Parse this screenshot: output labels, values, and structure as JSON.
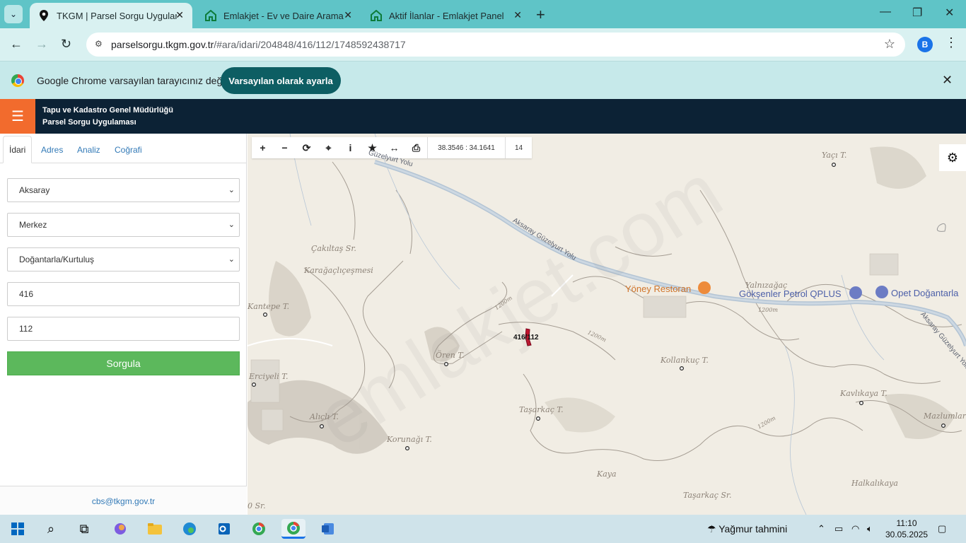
{
  "browser": {
    "tabs": [
      {
        "title": "TKGM | Parsel Sorgu Uygulaması",
        "active": true,
        "icon": "map-pin-icon"
      },
      {
        "title": "Emlakjet - Ev ve Daire Aramanın",
        "active": false,
        "icon": "house-icon"
      },
      {
        "title": "Aktif İlanlar - Emlakjet Panel",
        "active": false,
        "icon": "house-icon"
      }
    ],
    "url_host": "parselsorgu.tkgm.gov.tr",
    "url_path": "/#ara/idari/204848/416/112/1748592438717",
    "profile_initial": "B",
    "infobar_text": "Google Chrome varsayılan tarayıcınız değil",
    "infobar_button": "Varsayılan olarak ayarla"
  },
  "app": {
    "title_line1": "Tapu ve Kadastro Genel Müdürlüğü",
    "title_line2": "Parsel Sorgu Uygulaması",
    "accent": "#f26b2d",
    "header_bg": "#0c2235"
  },
  "sidebar": {
    "tabs": [
      "İdari",
      "Adres",
      "Analiz",
      "Coğrafi"
    ],
    "il": "Aksaray",
    "ilce": "Merkez",
    "mahalle": "Doğantarla/Kurtuluş",
    "ada": "416",
    "parsel": "112",
    "submit": "Sorgula",
    "email": "cbs@tkgm.gov.tr"
  },
  "map": {
    "coordinates": "38.3546 : 34.1641",
    "zoom": "14",
    "parcel_label": "416/112",
    "watermark": "emlakjet.com",
    "places": {
      "cakiltas": "Çakıltaş Sr.",
      "kavaklar": "Karağaçlıçeşmesi",
      "kantepe": "Kantepe T.",
      "oren": "Ören T.",
      "ercekli": "Erciyeli T.",
      "alici": "Alıçlı T.",
      "korunagi": "Korunağı T.",
      "tasarkac": "Taşarkaç T.",
      "tasarkac_sr": "Taşarkaç Sr.",
      "kollankuc": "Kollankuç T.",
      "kavlakaya": "Kavlıkaya T.",
      "mazlumlar": "Mazlumlar",
      "kaya": "Kaya",
      "halkalikaya": "Halkalıkaya",
      "yalnizagac": "Yalnızağaç",
      "yaci": "Yaçı T.",
      "sr_bottom": "0 Sr.",
      "contour1": "1200m",
      "contour2": "1200m",
      "contour3": "1200m",
      "contour4": "1200m"
    },
    "roads": {
      "r1": "Güzelyurt Yolu",
      "r2": "Aksaray Güzelyurt Yolu",
      "r3": "Aksaray Güzelyurt Yolu"
    },
    "pois": {
      "p1": "Yöney Restoran",
      "p2": "Gökşenler Petrol QPLUS",
      "p3": "Opet Doğantarla"
    }
  },
  "taskbar": {
    "weather": "Yağmur tahmini",
    "time": "11:10",
    "date": "30.05.2025"
  }
}
